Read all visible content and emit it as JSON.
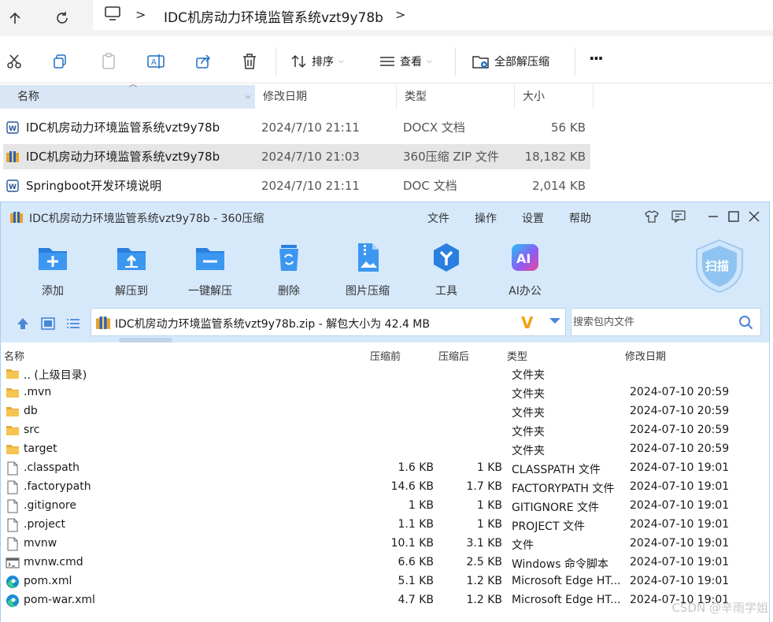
{
  "explorer": {
    "breadcrumb": "IDC机房动力环境监管系统vzt9y78b",
    "toolbar": {
      "sort_label": "排序",
      "view_label": "查看",
      "extract_all_label": "全部解压缩",
      "more_label": "···"
    },
    "columns": {
      "name": "名称",
      "date": "修改日期",
      "type": "类型",
      "size": "大小"
    },
    "files": [
      {
        "name": "IDC机房动力环境监管系统vzt9y78b",
        "date": "2024/7/10 21:11",
        "type": "DOCX 文档",
        "size": "56 KB",
        "icon": "word-doc-icon"
      },
      {
        "name": "IDC机房动力环境监管系统vzt9y78b",
        "date": "2024/7/10 21:03",
        "type": "360压缩 ZIP 文件",
        "size": "18,182 KB",
        "icon": "zip-archive-icon"
      },
      {
        "name": "Springboot开发环境说明",
        "date": "2024/7/10 21:11",
        "type": "DOC 文档",
        "size": "2,014 KB",
        "icon": "word-doc-icon"
      }
    ]
  },
  "zip": {
    "title": "IDC机房动力环境监管系统vzt9y78b - 360压缩",
    "menu": [
      "文件",
      "操作",
      "设置",
      "帮助"
    ],
    "tools": [
      "添加",
      "解压到",
      "一键解压",
      "删除",
      "图片压缩",
      "工具",
      "AI办公"
    ],
    "ai_badge": "AI",
    "scan_label": "扫描",
    "path": "IDC机房动力环境监管系统vzt9y78b.zip - 解包大小为 42.4 MB",
    "search_placeholder": "搜索包内文件",
    "columns": {
      "name": "名称",
      "pre": "压缩前",
      "post": "压缩后",
      "type": "类型",
      "date": "修改日期"
    },
    "rows": [
      {
        "name": ".. (上级目录)",
        "pre": "",
        "post": "",
        "type": "文件夹",
        "date": "",
        "icon": "folder-icon"
      },
      {
        "name": ".mvn",
        "pre": "",
        "post": "",
        "type": "文件夹",
        "date": "2024-07-10 20:59",
        "icon": "folder-icon"
      },
      {
        "name": "db",
        "pre": "",
        "post": "",
        "type": "文件夹",
        "date": "2024-07-10 20:59",
        "icon": "folder-icon"
      },
      {
        "name": "src",
        "pre": "",
        "post": "",
        "type": "文件夹",
        "date": "2024-07-10 20:59",
        "icon": "folder-icon"
      },
      {
        "name": "target",
        "pre": "",
        "post": "",
        "type": "文件夹",
        "date": "2024-07-10 20:59",
        "icon": "folder-icon"
      },
      {
        "name": ".classpath",
        "pre": "1.6 KB",
        "post": "1 KB",
        "type": "CLASSPATH 文件",
        "date": "2024-07-10 19:01",
        "icon": "file-icon"
      },
      {
        "name": ".factorypath",
        "pre": "14.6 KB",
        "post": "1.7 KB",
        "type": "FACTORYPATH 文件",
        "date": "2024-07-10 19:01",
        "icon": "file-icon"
      },
      {
        "name": ".gitignore",
        "pre": "1 KB",
        "post": "1 KB",
        "type": "GITIGNORE 文件",
        "date": "2024-07-10 19:01",
        "icon": "file-icon"
      },
      {
        "name": ".project",
        "pre": "1.1 KB",
        "post": "1 KB",
        "type": "PROJECT 文件",
        "date": "2024-07-10 19:01",
        "icon": "file-icon"
      },
      {
        "name": "mvnw",
        "pre": "10.1 KB",
        "post": "3.1 KB",
        "type": "文件",
        "date": "2024-07-10 19:01",
        "icon": "file-icon"
      },
      {
        "name": "mvnw.cmd",
        "pre": "6.6 KB",
        "post": "2.5 KB",
        "type": "Windows 命令脚本",
        "date": "2024-07-10 19:01",
        "icon": "cmd-script-icon"
      },
      {
        "name": "pom.xml",
        "pre": "5.1 KB",
        "post": "1.2 KB",
        "type": "Microsoft Edge HT...",
        "date": "2024-07-10 19:01",
        "icon": "edge-icon"
      },
      {
        "name": "pom-war.xml",
        "pre": "4.7 KB",
        "post": "1.2 KB",
        "type": "Microsoft Edge HT...",
        "date": "2024-07-10 19:01",
        "icon": "edge-icon"
      }
    ]
  },
  "watermark": "CSDN @辛雨学姐"
}
